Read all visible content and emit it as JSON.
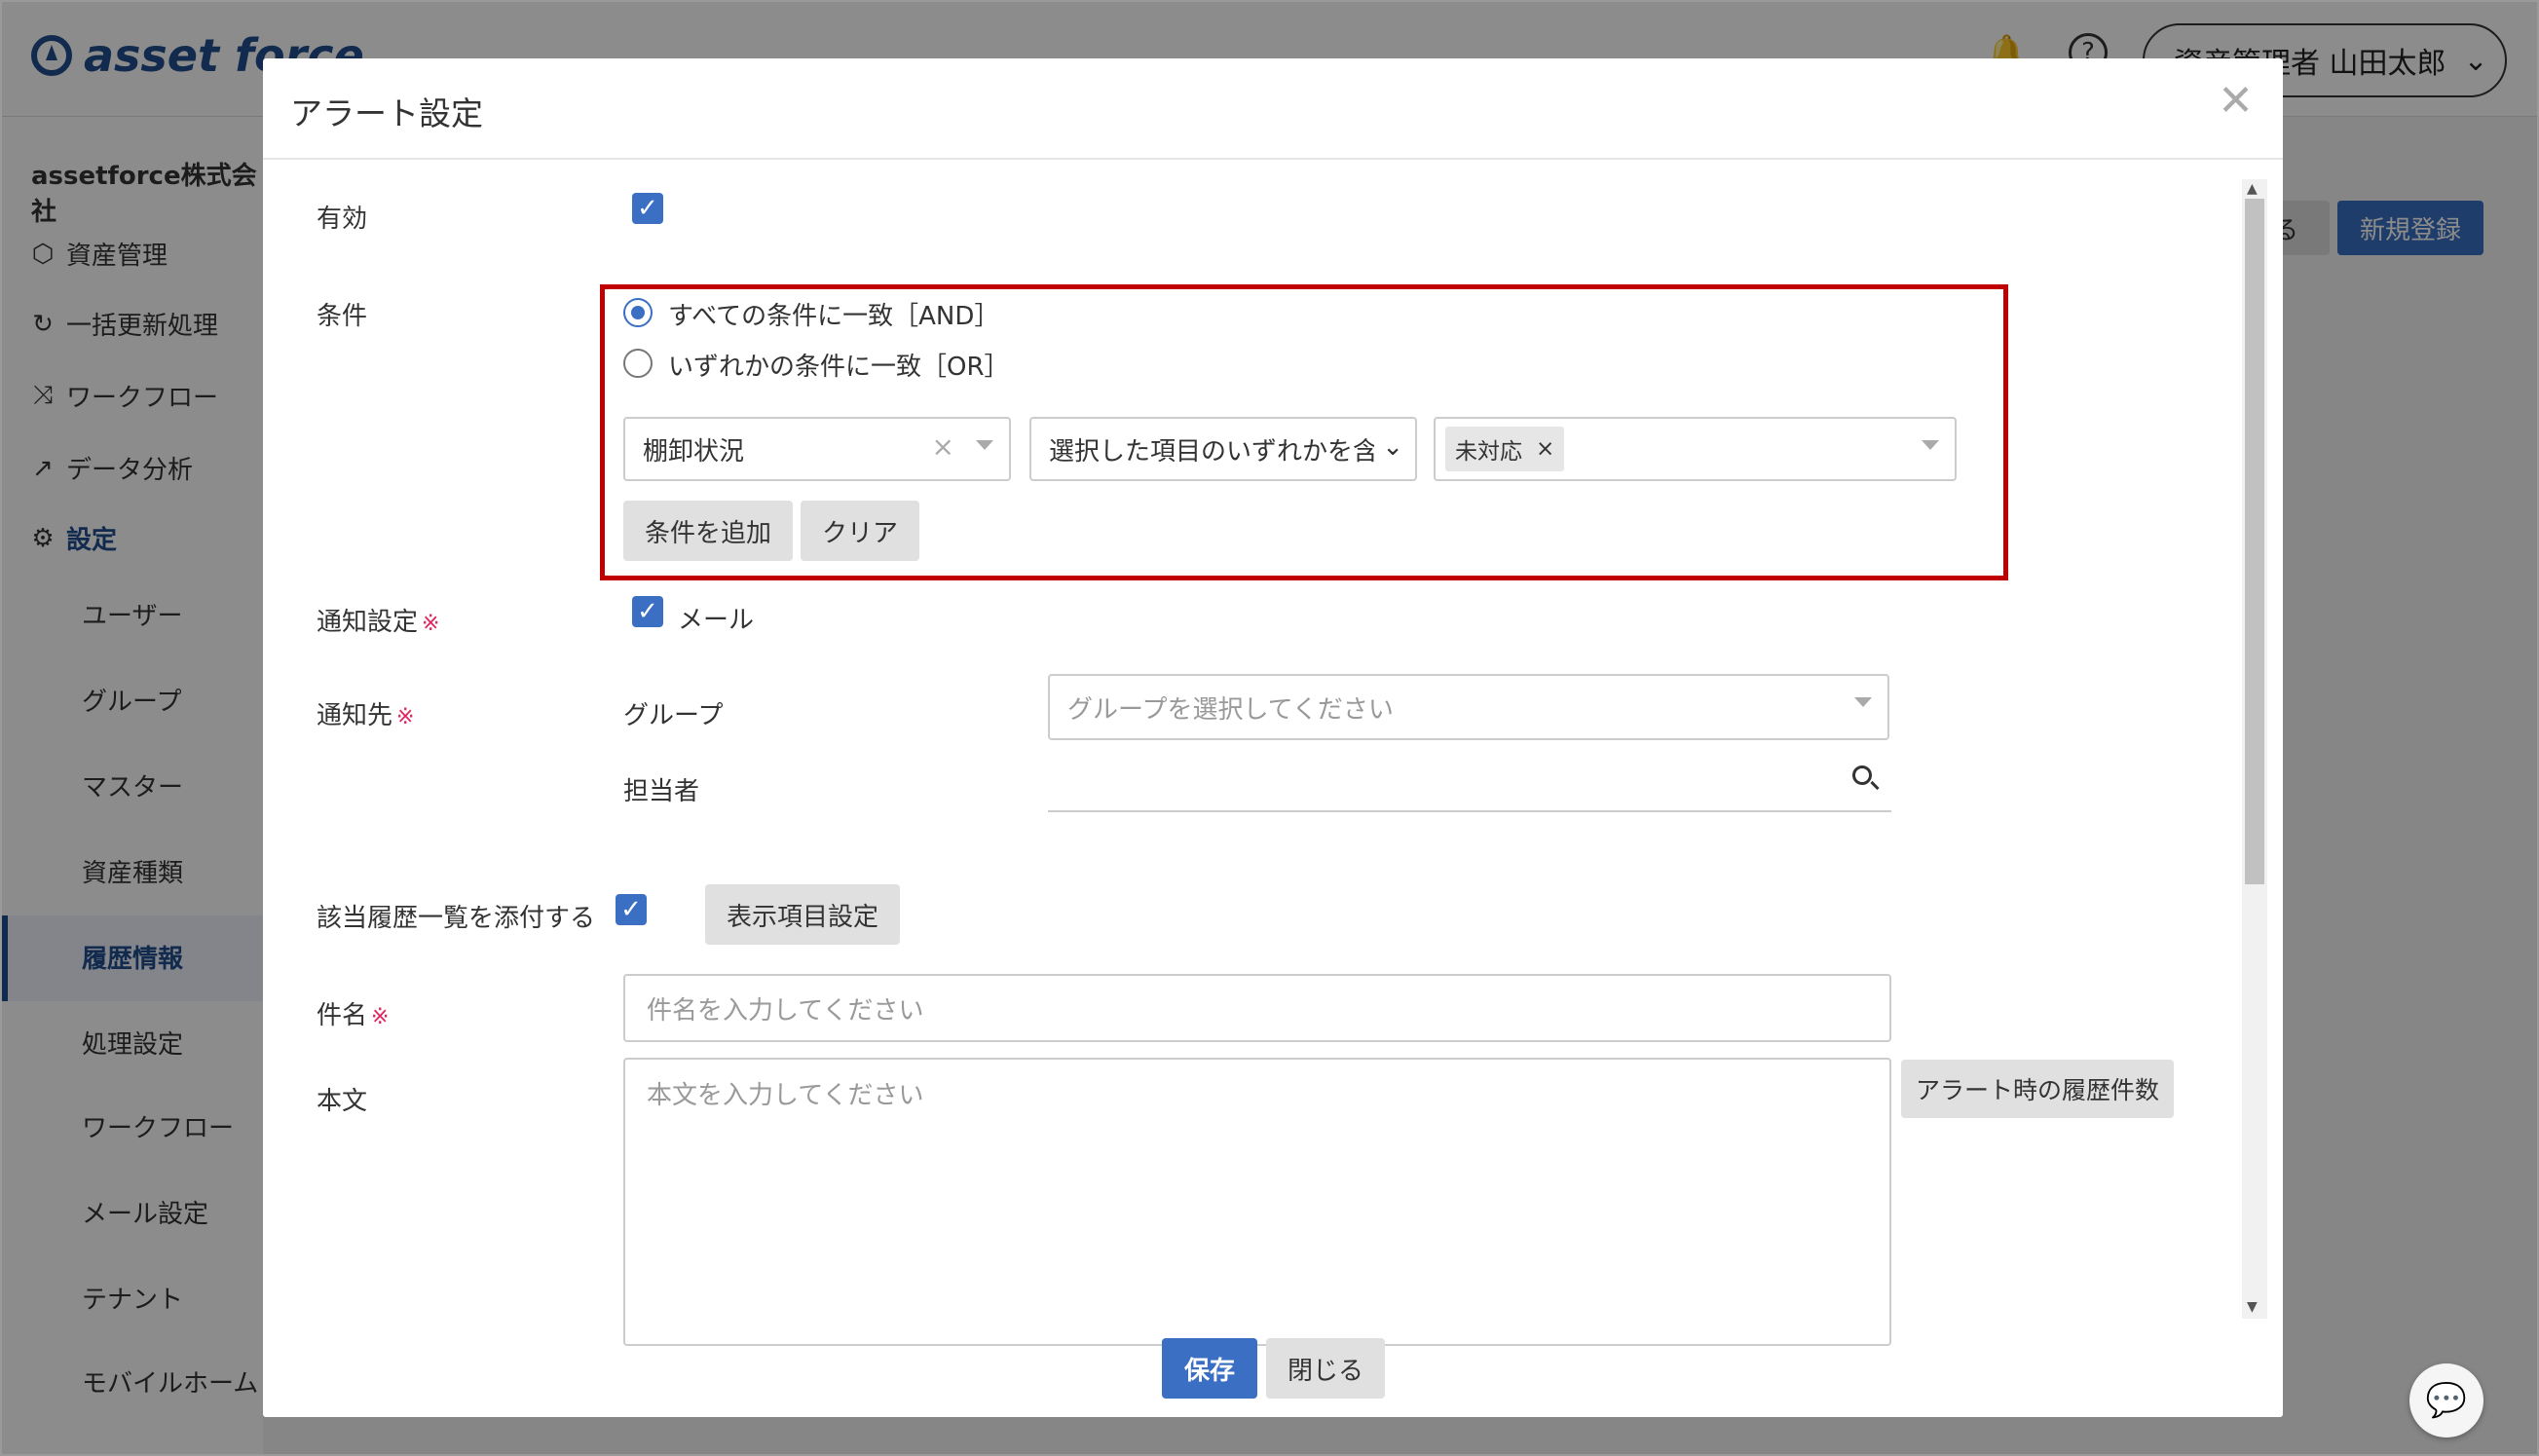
{
  "header": {
    "logo_text": "asset force",
    "user_label": "資産管理者 山田太郎"
  },
  "sidebar": {
    "company": "assetforce株式会社",
    "items": [
      {
        "label": "資産管理",
        "icon": "cube-icon"
      },
      {
        "label": "一括更新処理",
        "icon": "refresh-icon"
      },
      {
        "label": "ワークフロー",
        "icon": "workflow-icon"
      },
      {
        "label": "データ分析",
        "icon": "chart-icon"
      },
      {
        "label": "設定",
        "icon": "gear-icon"
      }
    ],
    "subitems": [
      "ユーザー",
      "グループ",
      "マスター",
      "資産種類",
      "履歴情報",
      "処理設定",
      "ワークフロー",
      "メール設定",
      "テナント",
      "モバイルホーム"
    ],
    "active_subitem": "履歴情報"
  },
  "main": {
    "new_button": "新規登録",
    "back_button": "る"
  },
  "modal": {
    "title": "アラート設定",
    "enabled_label": "有効",
    "condition_label": "条件",
    "radio_and": "すべての条件に一致［AND］",
    "radio_or": "いずれかの条件に一致［OR］",
    "field_select": "棚卸状況",
    "operator_select": "選択した項目のいずれかを含む",
    "value_tag": "未対応",
    "add_condition": "条件を追加",
    "clear": "クリア",
    "notify_setting_label": "通知設定",
    "notify_mail": "メール",
    "recipient_label": "通知先",
    "group_label": "グループ",
    "group_placeholder": "グループを選択してください",
    "person_label": "担当者",
    "attach_label": "該当履歴一覧を添付する",
    "display_items_button": "表示項目設定",
    "subject_label": "件名",
    "subject_placeholder": "件名を入力してください",
    "body_label": "本文",
    "body_placeholder": "本文を入力してください",
    "history_count_button": "アラート時の履歴件数",
    "required_mark": "※",
    "save": "保存",
    "close": "閉じる"
  }
}
